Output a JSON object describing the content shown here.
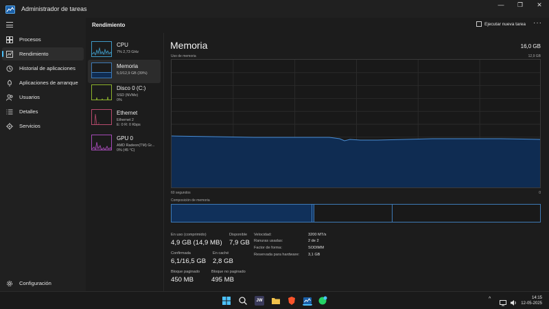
{
  "window": {
    "title": "Administrador de tareas",
    "controls": {
      "minimize": "—",
      "maximize": "❐",
      "close": "✕"
    }
  },
  "sidebar": {
    "items": [
      {
        "label": "Procesos",
        "icon": "processes-grid-icon"
      },
      {
        "label": "Rendimiento",
        "icon": "performance-chart-icon"
      },
      {
        "label": "Historial de aplicaciones",
        "icon": "history-icon"
      },
      {
        "label": "Aplicaciones de arranque",
        "icon": "startup-icon"
      },
      {
        "label": "Usuarios",
        "icon": "users-icon"
      },
      {
        "label": "Detalles",
        "icon": "details-list-icon"
      },
      {
        "label": "Servicios",
        "icon": "services-puzzle-icon"
      }
    ],
    "settings_label": "Configuración"
  },
  "header": {
    "title": "Rendimiento",
    "run_task_label": "Ejecutar nueva tarea",
    "more_label": "···"
  },
  "resources": [
    {
      "name": "CPU",
      "sub1": "7% 2,73 GHz",
      "sub2": "",
      "color": "#3f9bc8"
    },
    {
      "name": "Memoria",
      "sub1": "5,0/12,9 GB (39%)",
      "sub2": "",
      "color": "#3e7bb8"
    },
    {
      "name": "Disco 0 (C:)",
      "sub1": "SSD (NVMe)",
      "sub2": "0%",
      "color": "#8fb42d"
    },
    {
      "name": "Ethernet",
      "sub1": "Ethernet 2",
      "sub2": "E: 0 R: 0 Kbps",
      "color": "#b84b6e"
    },
    {
      "name": "GPU 0",
      "sub1": "AMD Radeon(TM) Gr...",
      "sub2": "0% (45 °C)",
      "color": "#a64bb8"
    }
  ],
  "memory": {
    "title": "Memoria",
    "total": "16,0 GB",
    "usage_label": "Uso de memoria",
    "usage_max": "12,9 GB",
    "time_left": "60 segundos",
    "time_right": "0",
    "composition_label": "Composición de memoria",
    "usage_fraction": 0.39
  },
  "stats": {
    "in_use_label": "En uso (comprimido)",
    "in_use_value": "4,9 GB (14,9 MB)",
    "available_label": "Disponible",
    "available_value": "7,9 GB",
    "committed_label": "Confirmada",
    "committed_value": "6,1/16,5 GB",
    "cached_label": "En caché",
    "cached_value": "2,8 GB",
    "paged_label": "Bloque paginado",
    "paged_value": "450 MB",
    "nonpaged_label": "Bloque no paginado",
    "nonpaged_value": "495 MB"
  },
  "details": [
    {
      "label": "Velocidad:",
      "value": "3200 MT/s"
    },
    {
      "label": "Ranuras usadas:",
      "value": "2 de 2"
    },
    {
      "label": "Factor de forma:",
      "value": "SODIMM"
    },
    {
      "label": "Reservada para hardware:",
      "value": "3,1 GB"
    }
  ],
  "taskbar": {
    "time": "14:15",
    "date": "12-05-2025",
    "chevron": "^",
    "app_labels": {
      "jw": "JW"
    }
  }
}
